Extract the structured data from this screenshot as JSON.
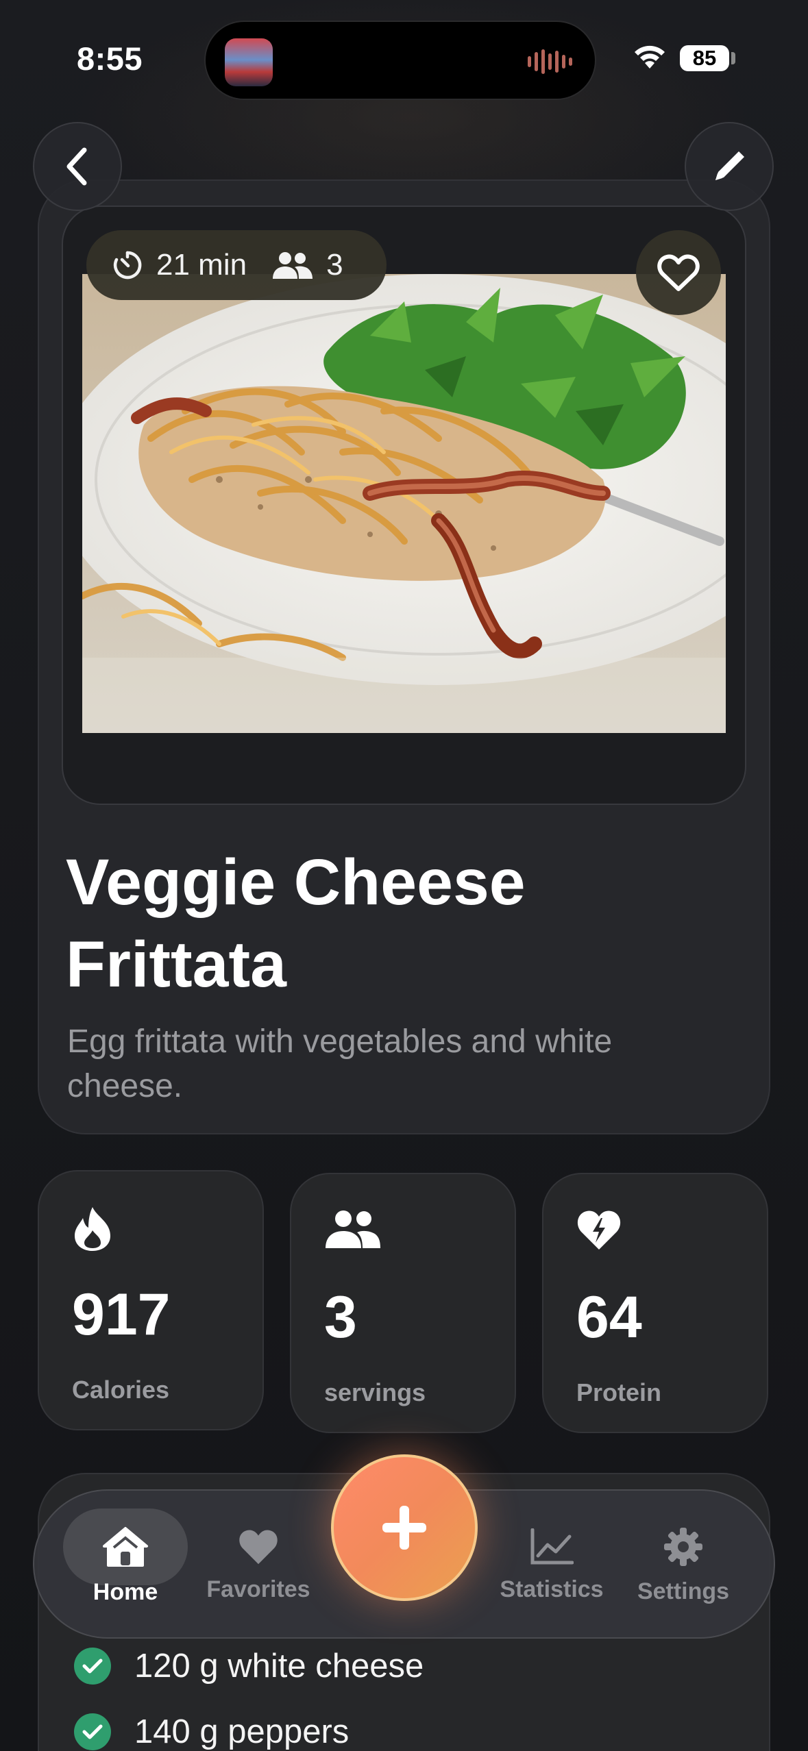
{
  "status_bar": {
    "time": "8:55",
    "battery": "85"
  },
  "header": {
    "back_icon": "chevron-left-icon",
    "edit_icon": "pencil-icon"
  },
  "recipe": {
    "cook_time": "21 min",
    "servings_badge": "3",
    "title": "Veggie Cheese Frittata",
    "description": "Egg frittata with vegetables and white cheese."
  },
  "stats": [
    {
      "icon": "flame-icon",
      "value": "917",
      "label": "Calories"
    },
    {
      "icon": "people-icon",
      "value": "3",
      "label": "servings"
    },
    {
      "icon": "heart-bolt-icon",
      "value": "64",
      "label": "Protein"
    }
  ],
  "ingredients": [
    {
      "text": "120 g white cheese",
      "checked": true
    },
    {
      "text": "140 g peppers",
      "checked": true
    }
  ],
  "tabbar": {
    "tabs": [
      {
        "label": "Home",
        "icon": "house-icon",
        "active": true
      },
      {
        "label": "Favorites",
        "icon": "heart-icon",
        "active": false
      },
      {
        "label": "Statistics",
        "icon": "chart-icon",
        "active": false
      },
      {
        "label": "Settings",
        "icon": "gear-icon",
        "active": false
      }
    ],
    "fab_icon": "plus-icon"
  },
  "colors": {
    "background": "#17181b",
    "card": "#26272b",
    "accent": "#f28a5a",
    "check": "#2f9e6e"
  }
}
